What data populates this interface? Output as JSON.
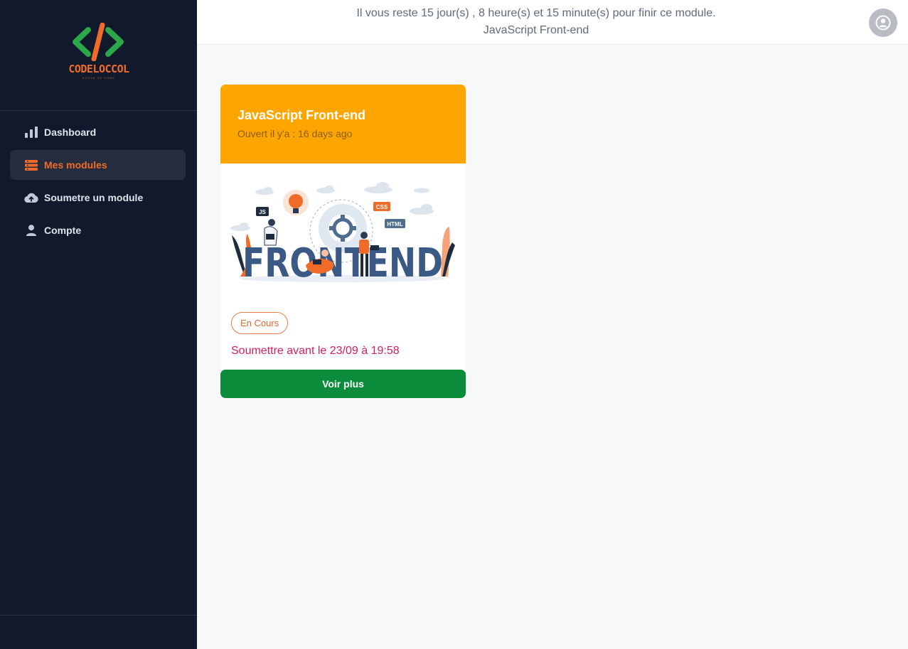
{
  "brand": {
    "name": "CODELOCCOL",
    "tagline": "ECOLE DE CODE",
    "accent": "#f06a28",
    "sidebar_bg": "#111a2c"
  },
  "sidebar": {
    "items": [
      {
        "label": "Dashboard",
        "icon": "bar-chart-icon",
        "active": false
      },
      {
        "label": "Mes modules",
        "icon": "list-icon",
        "active": true
      },
      {
        "label": "Soumetre un module",
        "icon": "cloud-upload-icon",
        "active": false
      },
      {
        "label": "Compte",
        "icon": "user-icon",
        "active": false
      }
    ]
  },
  "header": {
    "countdown": "Il vous reste 15 jour(s) , 8 heure(s) et 15 minute(s) pour finir ce module.",
    "module_name": "JavaScript Front-end",
    "avatar_icon": "user-circle-icon"
  },
  "module_card": {
    "title": "JavaScript Front-end",
    "opened": "Ouvert il y'a : 16 days ago",
    "header_color": "#ffa500",
    "illustration": {
      "word": "FRONTEND",
      "tags": [
        "JS",
        "CSS",
        "HTML"
      ]
    },
    "status": "En Cours",
    "deadline": "Soumettre avant le 23/09 à 19:58",
    "button_label": "Voir plus",
    "button_color": "#0b8c3a"
  }
}
